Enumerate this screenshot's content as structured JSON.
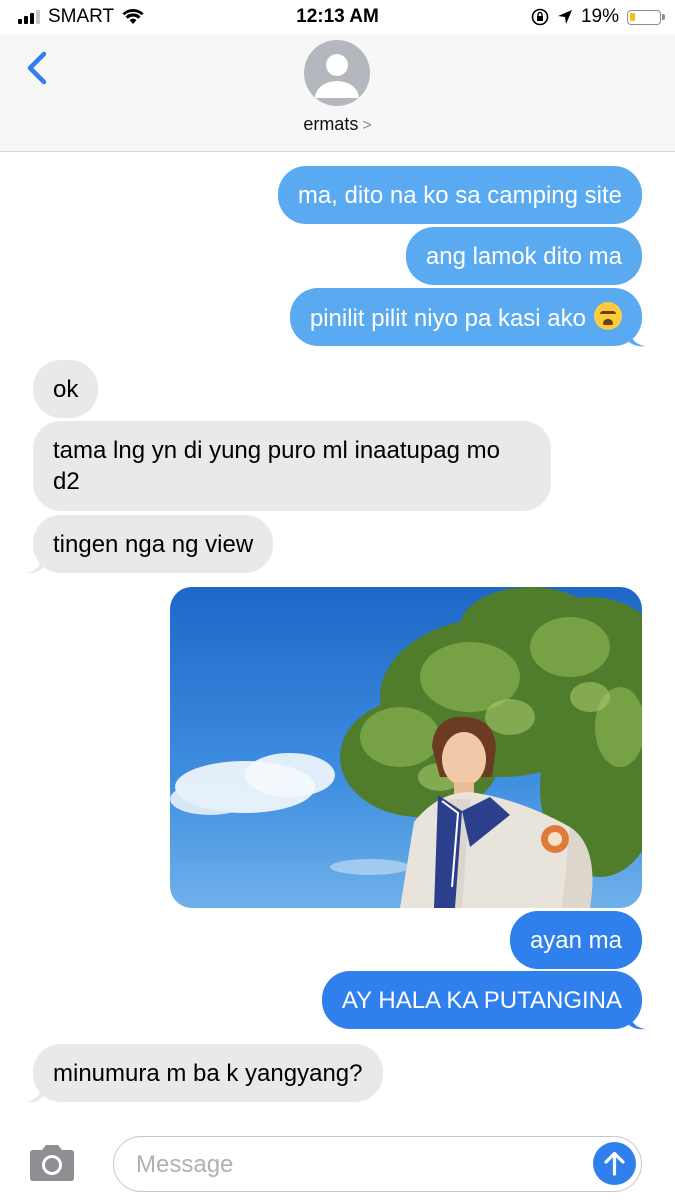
{
  "status_bar": {
    "carrier": "SMART",
    "time": "12:13 AM",
    "battery": "19%",
    "battery_level": 0.19,
    "icons": [
      "signal-icon",
      "wifi-icon",
      "orientation-lock-icon",
      "location-icon",
      "battery-icon"
    ]
  },
  "header": {
    "contact_name": "ermats",
    "chevron": ">",
    "icons": [
      "back-chevron-icon",
      "contact-avatar-icon"
    ]
  },
  "messages": [
    {
      "side": "outgoing",
      "text": "ma, dito na ko sa camping site"
    },
    {
      "side": "outgoing",
      "text": "ang lamok dito ma"
    },
    {
      "side": "outgoing",
      "text": "pinilit pilit niyo pa kasi ako",
      "emoji": "weary-face"
    },
    {
      "side": "incoming",
      "text": "ok"
    },
    {
      "side": "incoming",
      "text": "tama lng yn di yung puro ml inaatupag mo d2"
    },
    {
      "side": "incoming",
      "text": "tingen nga ng view"
    },
    {
      "side": "outgoing",
      "type": "photo",
      "description_icon": "photo-attachment"
    },
    {
      "side": "outgoing",
      "text": "ayan ma"
    },
    {
      "side": "outgoing",
      "text": "AY HALA KA PUTANGINA"
    },
    {
      "side": "incoming",
      "text": "minumura m ba k yangyang?"
    }
  ],
  "composer": {
    "placeholder": "Message",
    "icons": [
      "camera-icon",
      "send-arrow-icon"
    ]
  },
  "colors": {
    "outgoing_bubble": "#5aaaf2",
    "outgoing_bubble_delivered": "#2f80ec",
    "incoming_bubble": "#e9e9eb",
    "accent": "#2f80ec"
  }
}
